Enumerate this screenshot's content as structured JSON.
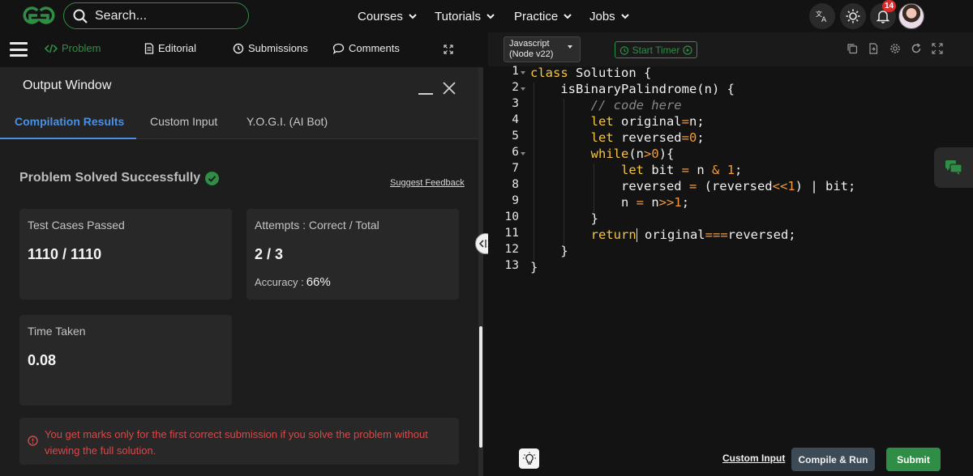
{
  "navbar": {
    "search_placeholder": "Search...",
    "menu": [
      "Courses",
      "Tutorials",
      "Practice",
      "Jobs"
    ],
    "notification_count": "14",
    "icons": [
      "gfg-logo-icon",
      "search-icon",
      "translate-icon",
      "theme-sun-icon",
      "bell-icon",
      "avatar"
    ]
  },
  "left_tabs": {
    "problem": "Problem",
    "editorial": "Editorial",
    "submissions": "Submissions",
    "comments": "Comments"
  },
  "output": {
    "title": "Output Window",
    "tabs": [
      "Compilation Results",
      "Custom Input",
      "Y.O.G.I. (AI Bot)"
    ],
    "active_tab": "Compilation Results",
    "status": "Problem Solved Successfully",
    "suggest_feedback": "Suggest Feedback",
    "test_cases_label": "Test Cases Passed",
    "test_cases_value": "1110 / 1110",
    "attempts_label": "Attempts : Correct / Total",
    "attempts_value": "2 / 3",
    "accuracy_label": "Accuracy :",
    "accuracy_value": "66%",
    "time_label": "Time Taken",
    "time_value": "0.08",
    "warning": "You get marks only for the first correct submission if you solve the problem without viewing the full solution."
  },
  "editor": {
    "language_line1": "Javascript",
    "language_line2": "(Node v22)",
    "timer_label": "Start Timer",
    "line_numbers": [
      "1",
      "2",
      "3",
      "4",
      "5",
      "6",
      "7",
      "8",
      "9",
      "10",
      "11",
      "12",
      "13"
    ],
    "custom_input": "Custom Input",
    "compile_run": "Compile & Run",
    "submit": "Submit"
  },
  "colors": {
    "brand_green": "#2f8d46",
    "active_tab_blue": "#4a90e2",
    "warning_red": "#d44a4a",
    "keyword": "#f4c542",
    "number": "#f29a3d"
  }
}
